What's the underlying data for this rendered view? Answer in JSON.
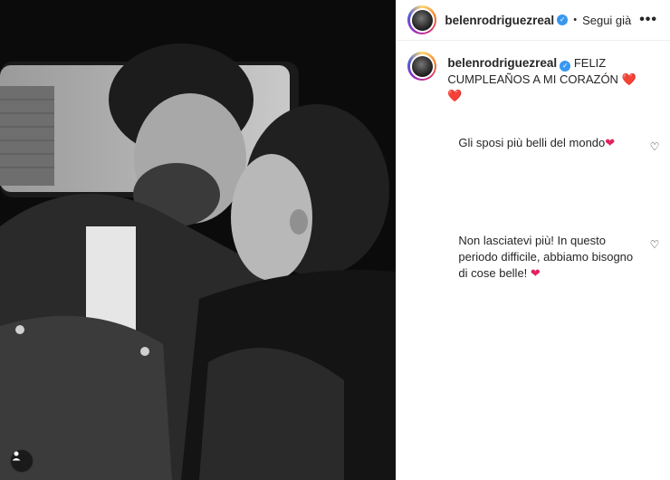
{
  "header": {
    "username": "belenrodriguezreal",
    "verified_mark": "✓",
    "separator": "•",
    "follow_label": "Segui già",
    "more_label": "•••"
  },
  "caption": {
    "username": "belenrodriguezreal",
    "verified_mark": "✓",
    "text": "FELIZ CUMPLEAÑOS A MI CORAZÓN ❤️❤️"
  },
  "comments": [
    {
      "text": "Gli sposi più belli del mondo",
      "emoji": "❤",
      "like_icon": "♡"
    },
    {
      "text": "Non lasciatevi più! In questo periodo difficile, abbiamo bisogno di cose belle!",
      "emoji": "❤",
      "like_icon": "♡"
    }
  ],
  "colors": {
    "accent_blue": "#3897f0",
    "heart_red": "#e0245e",
    "text": "#262626",
    "divider": "#efefef"
  },
  "icons": [
    "user-tag-icon",
    "verified-badge-icon",
    "more-options-icon",
    "heart-outline-icon"
  ]
}
